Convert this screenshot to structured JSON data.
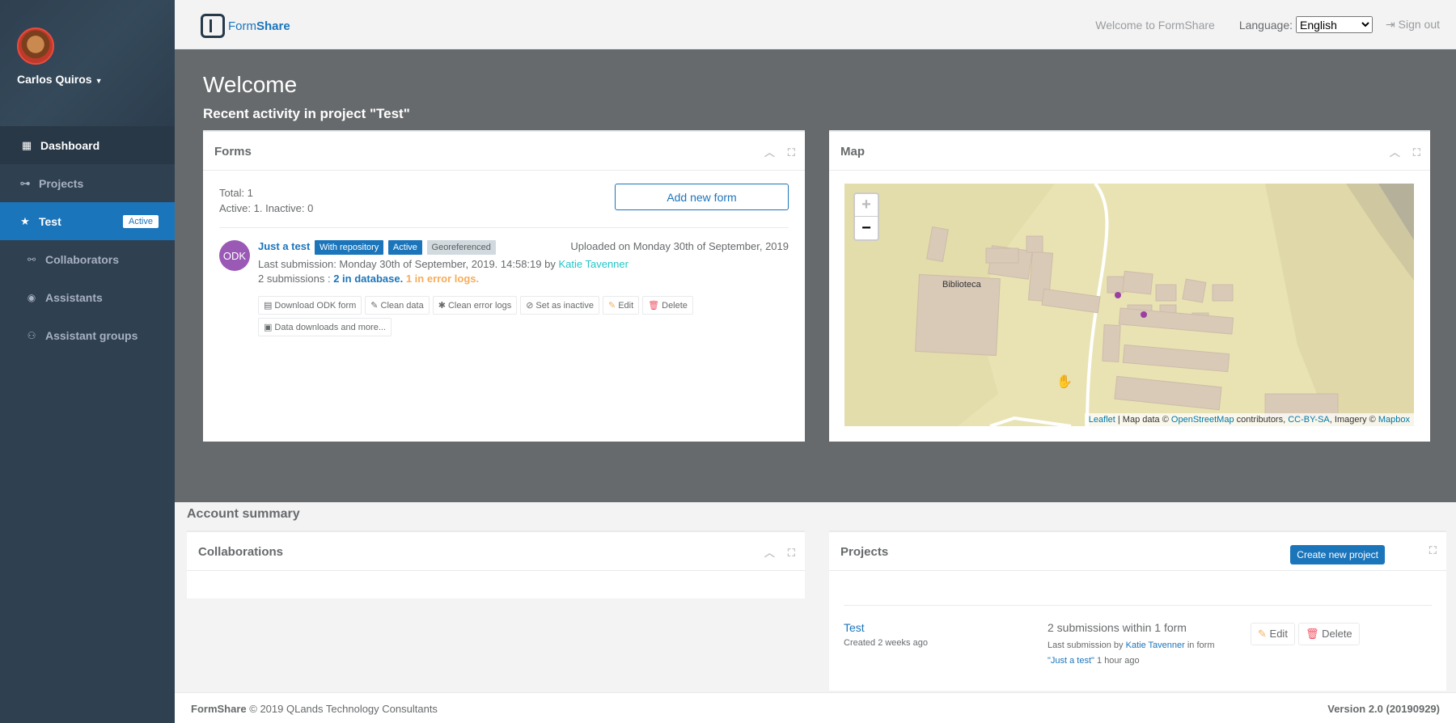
{
  "user": {
    "name": "Carlos Quiros"
  },
  "sidebar": {
    "items": [
      {
        "label": "Dashboard",
        "icon": "dashboard-icon"
      },
      {
        "label": "Projects",
        "icon": "sitemap-icon"
      },
      {
        "label": "Test",
        "icon": "star-icon",
        "badge": "Active"
      },
      {
        "label": "Collaborators",
        "icon": "handshake-icon"
      },
      {
        "label": "Assistants",
        "icon": "user-circle-icon"
      },
      {
        "label": "Assistant groups",
        "icon": "users-icon"
      }
    ]
  },
  "topbar": {
    "brand_form": "Form",
    "brand_share": "Share",
    "welcome": "Welcome to FormShare",
    "language_label": "Language:",
    "language_value": "English",
    "signout": "Sign out"
  },
  "page": {
    "title": "Welcome",
    "subtitle": "Recent activity in project \"Test\""
  },
  "forms_panel": {
    "title": "Forms",
    "total": "Total: 1",
    "active_line": "Active: 1. Inactive: 0",
    "add_button": "Add new form",
    "form": {
      "avatar": "ODK",
      "name": "Just a test",
      "labels": [
        "With repository",
        "Active",
        "Georeferenced"
      ],
      "uploaded": "Uploaded on Monday 30th of September, 2019",
      "last_submission_prefix": "Last submission: Monday 30th of September, 2019. 14:58:19 by",
      "last_submission_user": "Katie Tavenner",
      "subs_prefix": "2 submissions :",
      "subs_db": "2 in database.",
      "subs_err": "1 in error logs.",
      "actions": [
        "Download ODK form",
        "Clean data",
        "Clean error logs",
        "Set as inactive",
        "Edit",
        "Delete",
        "Data downloads and more..."
      ]
    }
  },
  "map_panel": {
    "title": "Map",
    "zoom_in": "+",
    "zoom_out": "−",
    "place_label": "Biblioteca",
    "attribution": {
      "leaflet": "Leaflet",
      "map_data": "| Map data ©",
      "osm": "OpenStreetMap",
      "contributors": "contributors,",
      "license": "CC-BY-SA",
      "imagery": ", Imagery ©",
      "mapbox": "Mapbox"
    }
  },
  "account": {
    "title": "Account summary",
    "collaborations_title": "Collaborations",
    "projects_title": "Projects",
    "create_button": "Create new project",
    "project": {
      "name": "Test",
      "created": "Created 2 weeks ago",
      "submissions": "2 submissions within 1 form",
      "last_prefix": "Last submission by",
      "last_user": "Katie Tavenner",
      "in_form": "in form",
      "form_name": "\"Just a test\"",
      "time": "1 hour ago",
      "edit": "Edit",
      "delete": "Delete"
    }
  },
  "footer": {
    "brand": "FormShare",
    "copyright": "© 2019 QLands Technology Consultants",
    "version": "Version 2.0 (20190929)"
  },
  "colors": {
    "primary": "#1b75bb",
    "sidebar": "#2f4050",
    "content_dark": "#676a6c",
    "warning": "#f8ac59",
    "danger": "#ed5565",
    "purple": "#9b59b6"
  }
}
